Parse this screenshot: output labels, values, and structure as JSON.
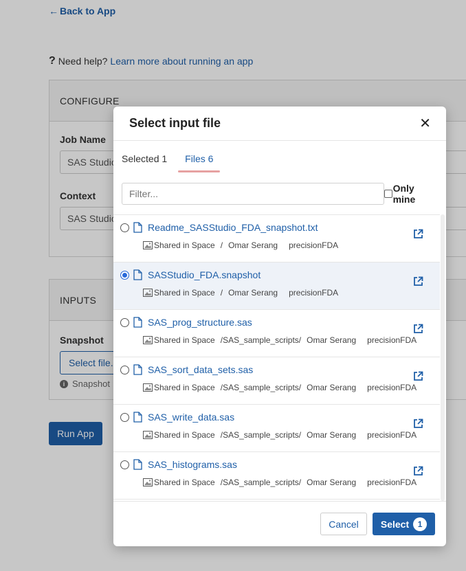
{
  "page": {
    "back_link": "Back to App",
    "help_prefix": "Need help?",
    "help_link": "Learn more about running an app",
    "configure_title": "CONFIGURE",
    "job_name_label": "Job Name",
    "job_name_value": "SAS Studio",
    "context_label": "Context",
    "context_value": "SAS Studio",
    "inputs_title": "INPUTS",
    "snapshot_label": "Snapshot",
    "select_file_label": "Select file...",
    "snapshot_help": "Snapshot",
    "run_app_label": "Run App"
  },
  "modal": {
    "title": "Select input file",
    "close_symbol": "✕",
    "tabs": [
      {
        "label": "Selected 1",
        "active": false
      },
      {
        "label": "Files 6",
        "active": true
      }
    ],
    "filter_placeholder": "Filter...",
    "only_mine_label": "Only mine",
    "files": [
      {
        "name": "Readme_SASStudio_FDA_snapshot.txt",
        "scope": "Shared in Space",
        "path": "/",
        "owner": "Omar Serang",
        "org": "precisionFDA",
        "selected": false
      },
      {
        "name": "SASStudio_FDA.snapshot",
        "scope": "Shared in Space",
        "path": "/",
        "owner": "Omar Serang",
        "org": "precisionFDA",
        "selected": true
      },
      {
        "name": "SAS_prog_structure.sas",
        "scope": "Shared in Space",
        "path": "/SAS_sample_scripts/",
        "owner": "Omar Serang",
        "org": "precisionFDA",
        "selected": false
      },
      {
        "name": "SAS_sort_data_sets.sas",
        "scope": "Shared in Space",
        "path": "/SAS_sample_scripts/",
        "owner": "Omar Serang",
        "org": "precisionFDA",
        "selected": false
      },
      {
        "name": "SAS_write_data.sas",
        "scope": "Shared in Space",
        "path": "/SAS_sample_scripts/",
        "owner": "Omar Serang",
        "org": "precisionFDA",
        "selected": false
      },
      {
        "name": "SAS_histograms.sas",
        "scope": "Shared in Space",
        "path": "/SAS_sample_scripts/",
        "owner": "Omar Serang",
        "org": "precisionFDA",
        "selected": false
      }
    ],
    "cancel_label": "Cancel",
    "select_label": "Select",
    "select_count": "1"
  },
  "colors": {
    "primary": "#1f5fa8",
    "tab_underline": "#e6a1a1",
    "selected_row": "#eef2f8"
  }
}
